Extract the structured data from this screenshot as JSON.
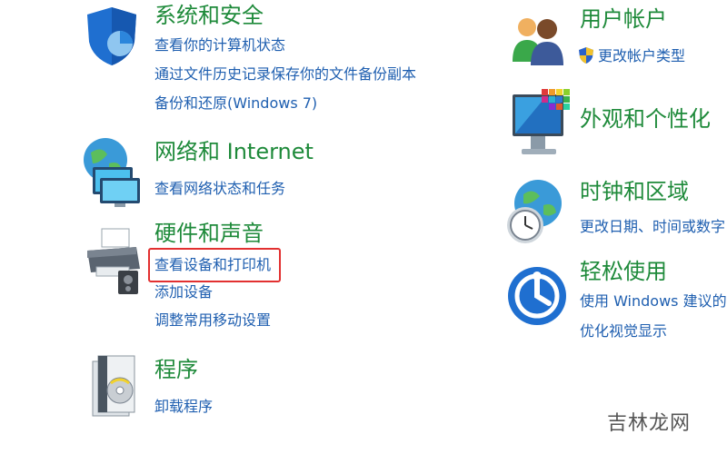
{
  "categories": {
    "system_security": {
      "title": "系统和安全",
      "links": [
        "查看你的计算机状态",
        "通过文件历史记录保存你的文件备份副本",
        "备份和还原(Windows 7)"
      ]
    },
    "user_accounts": {
      "title": "用户帐户",
      "links": [
        "更改帐户类型"
      ]
    },
    "network": {
      "title": "网络和 Internet",
      "links": [
        "查看网络状态和任务"
      ]
    },
    "appearance": {
      "title": "外观和个性化",
      "links": []
    },
    "hardware_sound": {
      "title": "硬件和声音",
      "links": [
        "查看设备和打印机",
        "添加设备",
        "调整常用移动设置"
      ]
    },
    "clock_region": {
      "title": "时钟和区域",
      "links": [
        "更改日期、时间或数字"
      ]
    },
    "ease_of_access": {
      "title": "轻松使用",
      "links": [
        "使用 Windows 建议的",
        "优化视觉显示"
      ]
    },
    "programs": {
      "title": "程序",
      "links": [
        "卸载程序"
      ]
    }
  },
  "highlight": {
    "color": "#e23030"
  },
  "colors": {
    "title": "#1e8a3a",
    "link": "#1f5fb0"
  },
  "watermark": "吉林龙网"
}
